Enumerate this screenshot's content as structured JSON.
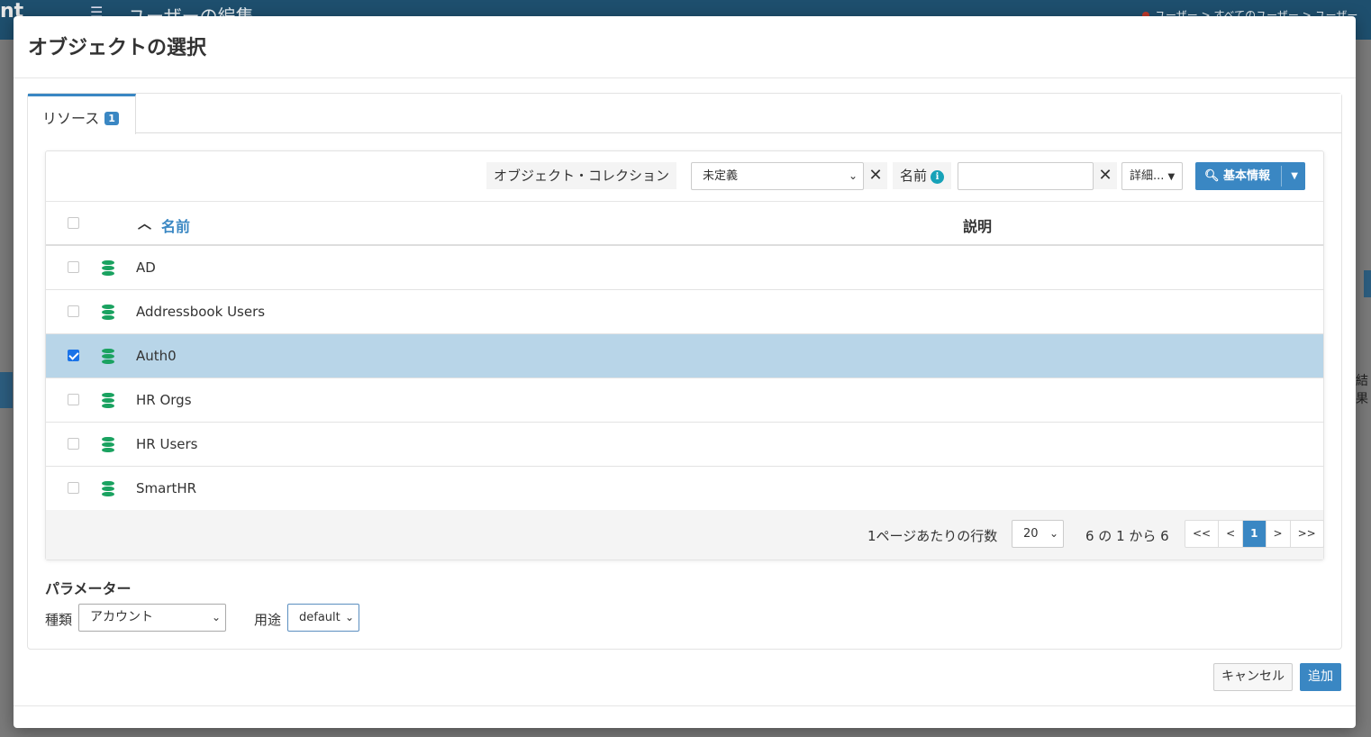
{
  "background": {
    "logo": "nt",
    "menu_icon": "hamburger-icon",
    "title": "ユーザーの編集",
    "breadcrumb": "ユーザー > すべてのユーザー > ユーザー",
    "right_fragment": "結果"
  },
  "modal": {
    "title": "オブジェクトの選択",
    "tab": {
      "label": "リソース",
      "badge": "1"
    },
    "filters": {
      "collection_label": "オブジェクト・コレクション",
      "collection_value": "未定義",
      "name_label": "名前",
      "name_value": "",
      "more_label": "詳細...",
      "search_label": "基本情報",
      "clear_icon": "close-icon"
    },
    "table": {
      "columns": {
        "name": "名前",
        "description": "説明"
      },
      "rows": [
        {
          "name": "AD",
          "description": "",
          "checked": false
        },
        {
          "name": "Addressbook Users",
          "description": "",
          "checked": false
        },
        {
          "name": "Auth0",
          "description": "",
          "checked": true
        },
        {
          "name": "HR Orgs",
          "description": "",
          "checked": false
        },
        {
          "name": "HR Users",
          "description": "",
          "checked": false
        },
        {
          "name": "SmartHR",
          "description": "",
          "checked": false
        }
      ]
    },
    "pagination": {
      "per_page_label": "1ページあたりの行数",
      "per_page_value": "20",
      "range_text": "6 の 1 から 6",
      "first": "<<",
      "prev": "<",
      "current": "1",
      "next": ">",
      "last": ">>"
    },
    "parameters": {
      "title": "パラメーター",
      "type_label": "種類",
      "type_value": "アカウント",
      "use_label": "用途",
      "use_value": "default"
    },
    "buttons": {
      "cancel": "キャンセル",
      "add": "追加"
    }
  },
  "colors": {
    "accent": "#3a87c3",
    "selected_row": "#b8d5e8",
    "db_icon": "#1aa260"
  }
}
